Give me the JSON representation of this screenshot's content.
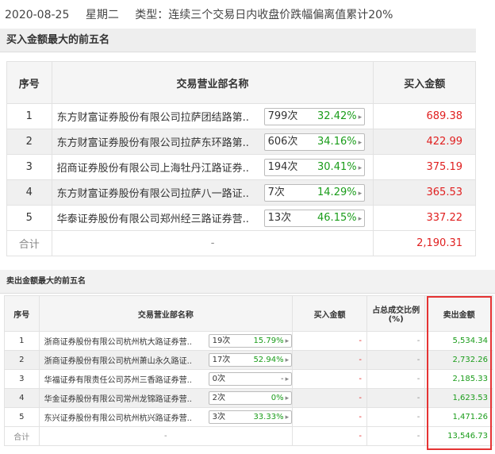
{
  "header": {
    "date": "2020-08-25",
    "weekday": "星期二",
    "type": "类型：连续三个交易日内收盘价跌幅偏离值累计20%"
  },
  "buy_section": {
    "title": "买入金额最大的前五名",
    "columns": [
      "序号",
      "交易营业部名称",
      "买入金额"
    ],
    "rows": [
      {
        "no": "1",
        "name": "东方财富证券股份有限公司拉萨团结路第..",
        "count": "799次",
        "pct": "32.42%",
        "amount": "689.38"
      },
      {
        "no": "2",
        "name": "东方财富证券股份有限公司拉萨东环路第..",
        "count": "606次",
        "pct": "34.16%",
        "amount": "422.99"
      },
      {
        "no": "3",
        "name": "招商证券股份有限公司上海牡丹江路证券..",
        "count": "194次",
        "pct": "30.41%",
        "amount": "375.19"
      },
      {
        "no": "4",
        "name": "东方财富证券股份有限公司拉萨八一路证..",
        "count": "7次",
        "pct": "14.29%",
        "amount": "365.53"
      },
      {
        "no": "5",
        "name": "华泰证券股份有限公司郑州经三路证券营..",
        "count": "13次",
        "pct": "46.15%",
        "amount": "337.22"
      }
    ],
    "total": {
      "label": "合计",
      "name": "-",
      "amount": "2,190.31"
    }
  },
  "sell_section": {
    "title": "卖出金额最大的前五名",
    "columns": [
      "序号",
      "交易营业部名称",
      "买入金额",
      "占总成交比例(%)",
      "卖出金额"
    ],
    "rows": [
      {
        "no": "1",
        "name": "浙商证券股份有限公司杭州杭大路证券营..",
        "count": "19次",
        "pct": "15.79%",
        "buy": "-",
        "ratio": "-",
        "sell": "5,534.34"
      },
      {
        "no": "2",
        "name": "浙商证券股份有限公司杭州萧山永久路证..",
        "count": "17次",
        "pct": "52.94%",
        "buy": "-",
        "ratio": "-",
        "sell": "2,732.26"
      },
      {
        "no": "3",
        "name": "华福证券有限责任公司苏州三香路证券营..",
        "count": "0次",
        "pct": "-",
        "buy": "-",
        "ratio": "-",
        "sell": "2,185.33"
      },
      {
        "no": "4",
        "name": "华金证券股份有限公司常州龙锦路证券营..",
        "count": "2次",
        "pct": "0%",
        "buy": "-",
        "ratio": "-",
        "sell": "1,623.53"
      },
      {
        "no": "5",
        "name": "东兴证券股份有限公司杭州杭兴路证券营..",
        "count": "3次",
        "pct": "33.33%",
        "buy": "-",
        "ratio": "-",
        "sell": "1,471.26"
      }
    ],
    "total": {
      "label": "合计",
      "name": "-",
      "buy": "-",
      "ratio": "-",
      "sell": "13,546.73"
    }
  },
  "colors": {
    "red": "#e02020",
    "green": "#1a9c1a",
    "highlight_box": "#e53333"
  }
}
